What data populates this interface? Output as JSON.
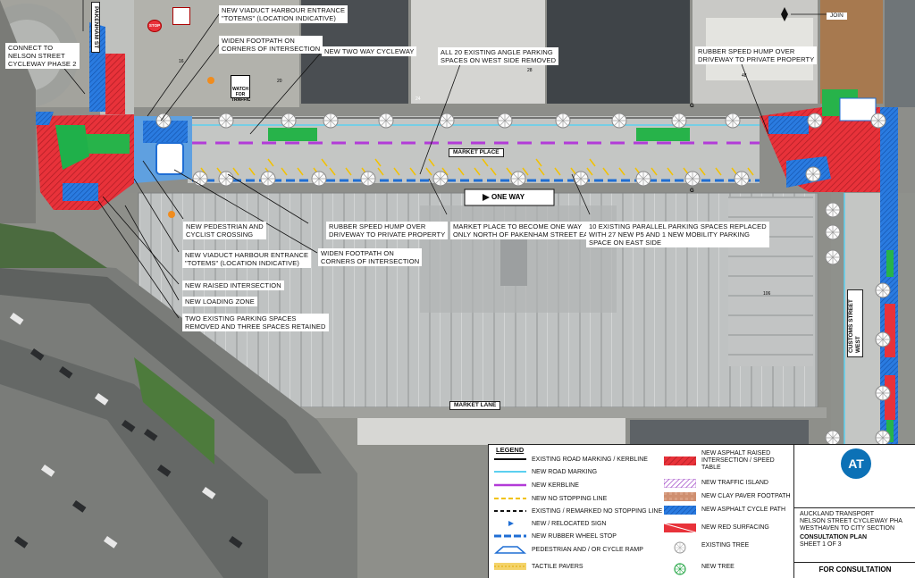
{
  "annotations": {
    "connect": "CONNECT TO\nNELSON STREET\nCYCLEWAY PHASE 2",
    "totem_top": "NEW VIADUCT HARBOUR ENTRANCE\n\"TOTEMS\" (LOCATION INDICATIVE)",
    "widen_top": "WIDEN FOOTPATH ON\nCORNERS OF INTERSECTION",
    "two_way": "NEW TWO WAY CYCLEWAY",
    "angle_parking": "ALL 20 EXISTING ANGLE PARKING\nSPACES ON WEST SIDE REMOVED",
    "hump_top": "RUBBER SPEED HUMP OVER\nDRIVEWAY TO PRIVATE PROPERTY",
    "ped_crossing": "NEW PEDESTRIAN AND\nCYCLIST CROSSING",
    "hump_mid": "RUBBER SPEED HUMP OVER\nDRIVEWAY TO PRIVATE PROPERTY",
    "one_way_note": "MARKET PLACE TO BECOME ONE WAY\nONLY NORTH OF PAKENHAM STREET EAST",
    "parallel_parking": "10 EXISTING PARALLEL PARKING SPACES REPLACED\nWITH 27 NEW P5 AND 1 NEW  MOBILITY PARKING\nSPACE ON EAST SIDE",
    "totem_bottom": "NEW VIADUCT HARBOUR ENTRANCE\n\"TOTEMS\" (LOCATION INDICATIVE)",
    "widen_bottom": "WIDEN FOOTPATH ON\nCORNERS OF INTERSECTION",
    "raised": "NEW RAISED INTERSECTION",
    "loading": "NEW LOADING ZONE",
    "two_existing": "TWO EXISTING PARKING SPACES\nREMOVED AND THREE SPACES RETAINED"
  },
  "road_labels": {
    "market_place": "MARKET PLACE",
    "market_lane": "MARKET LANE",
    "one_way": "ONE WAY",
    "join": "JOIN",
    "pakenham": "PAKENHAM ST",
    "customs": "CUSTOMS STREET WEST"
  },
  "map_text": {
    "watch_traffic": "WATCH FOR TRAFFIC",
    "stop": "STOP",
    "g_top": "G",
    "g_bottom": "G",
    "lot_16": "16",
    "lot_20": "20",
    "lot_24": "24",
    "lot_28": "28",
    "lot_48": "48",
    "lot_106": "106"
  },
  "legend": {
    "title": "LEGEND",
    "left": [
      {
        "label": "EXISTING ROAD MARKING / KERBLINE",
        "sw": "black-line"
      },
      {
        "label": "NEW ROAD MARKING",
        "sw": "cyan-line"
      },
      {
        "label": "NEW KERBLINE",
        "sw": "magenta-line"
      },
      {
        "label": "NEW NO STOPPING LINE",
        "sw": "yellow-dash"
      },
      {
        "label": "EXISTING / REMARKED NO STOPPING LINE",
        "sw": "black-dash"
      },
      {
        "label": "NEW / RELOCATED SIGN",
        "sw": "sign"
      },
      {
        "label": "NEW RUBBER WHEEL STOP",
        "sw": "wheelstop"
      },
      {
        "label": "PEDESTRIAN AND / OR CYCLE RAMP",
        "sw": "ramp"
      },
      {
        "label": "TACTILE PAVERS",
        "sw": "tactile"
      }
    ],
    "right": [
      {
        "label": "NEW ASPHALT RAISED\nINTERSECTION / SPEED TABLE",
        "sw": "red-hatch"
      },
      {
        "label": "NEW TRAFFIC ISLAND",
        "sw": "purple-hatch"
      },
      {
        "label": "NEW CLAY PAVER FOOTPATH",
        "sw": "clay"
      },
      {
        "label": "NEW ASPHALT CYCLE PATH",
        "sw": "blue-hatch"
      },
      {
        "label": "NEW RED SURFACING",
        "sw": "red-surf"
      },
      {
        "label": "EXISTING TREE",
        "sw": "tree-grey"
      },
      {
        "label": "NEW TREE",
        "sw": "tree-green"
      }
    ]
  },
  "title_block": {
    "logo": "AT",
    "line1": "AUCKLAND TRANSPORT",
    "line2": "NELSON STREET CYCLEWAY PHA",
    "line3": "WESTHAVEN TO CITY SECTION",
    "line4": "CONSULTATION PLAN",
    "line5": "SHEET 1 OF 3",
    "footer": "FOR CONSULTATION"
  },
  "colors": {
    "red": "#e8323a",
    "blue": "#1f6ed4",
    "green": "#27b34a",
    "magenta": "#b23bd8",
    "cyan": "#5cd0f0",
    "yellow": "#f2c200",
    "road": "#c4c6c4",
    "roof": "#b9bcbc"
  }
}
